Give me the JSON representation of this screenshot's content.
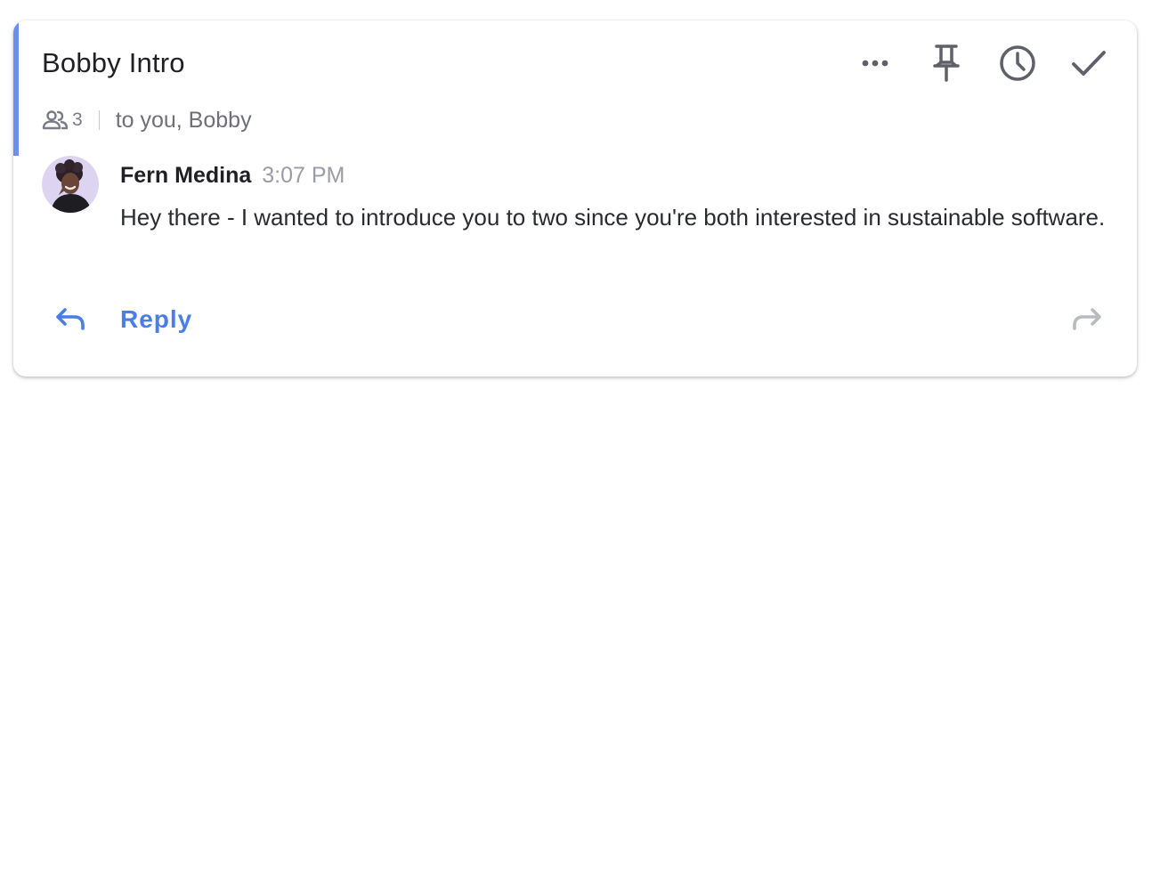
{
  "colors": {
    "accent": "#6b8ff0",
    "reply_blue": "#4a7de6",
    "icon_gray": "#5f6068",
    "forward_gray": "#b9bac0"
  },
  "thread": {
    "title": "Bobby Intro",
    "participant_count": "3",
    "recipients": "to you, Bobby"
  },
  "toolbar": {
    "more": "more-horizontal-icon",
    "pin": "pin-icon",
    "snooze": "clock-icon",
    "done": "check-icon"
  },
  "message": {
    "sender": "Fern Medina",
    "time": "3:07 PM",
    "body": "Hey there - I wanted to introduce you to two since you're both interested in sustainable software."
  },
  "actions": {
    "reply_label": "Reply",
    "reply_icon": "reply-arrow-icon",
    "forward_icon": "forward-arrow-icon"
  }
}
